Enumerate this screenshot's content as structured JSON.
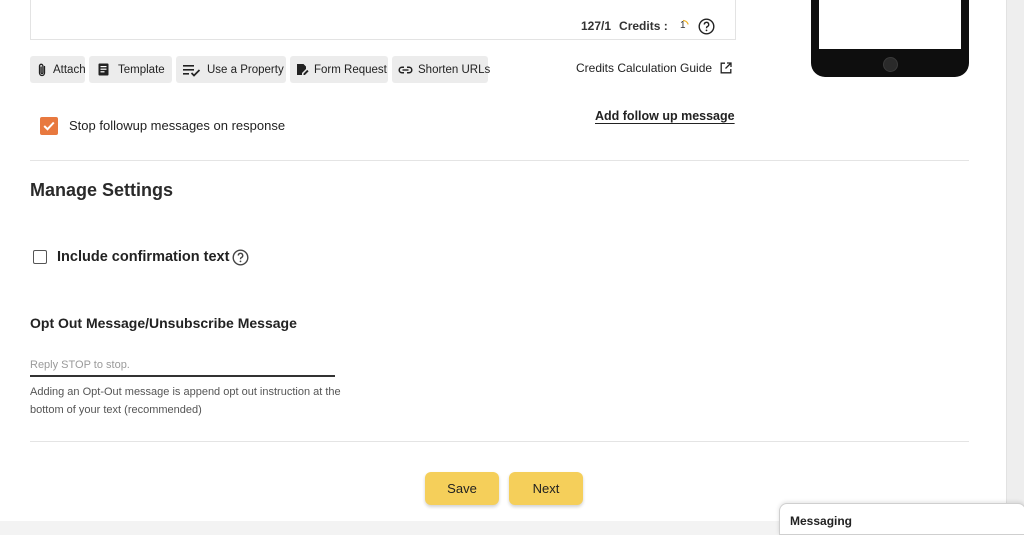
{
  "message": {
    "counter": "127/1",
    "credits_label": "Credits :",
    "credits_value": "1"
  },
  "toolbar": {
    "attach": "Attach",
    "template": "Template",
    "use_property": "Use a Property",
    "form_request": "Form Request",
    "shorten_urls": "Shorten URLs"
  },
  "credits_guide": "Credits Calculation Guide",
  "followup": {
    "stop_label": "Stop followup messages on response",
    "stop_checked": true,
    "add_label": "Add follow up message"
  },
  "settings": {
    "title": "Manage Settings",
    "include_confirmation": "Include confirmation text",
    "include_confirmation_checked": false,
    "optout_title": "Opt Out Message/Unsubscribe Message",
    "optout_placeholder": "Reply STOP to stop.",
    "optout_value": "",
    "optout_help": "Adding an Opt-Out message is append opt out instruction at the bottom of your text (recommended)"
  },
  "actions": {
    "save": "Save",
    "next": "Next"
  },
  "messaging_panel": {
    "title": "Messaging"
  },
  "colors": {
    "accent_checkbox": "#e8793f",
    "button_yellow": "#f5cf5a"
  }
}
